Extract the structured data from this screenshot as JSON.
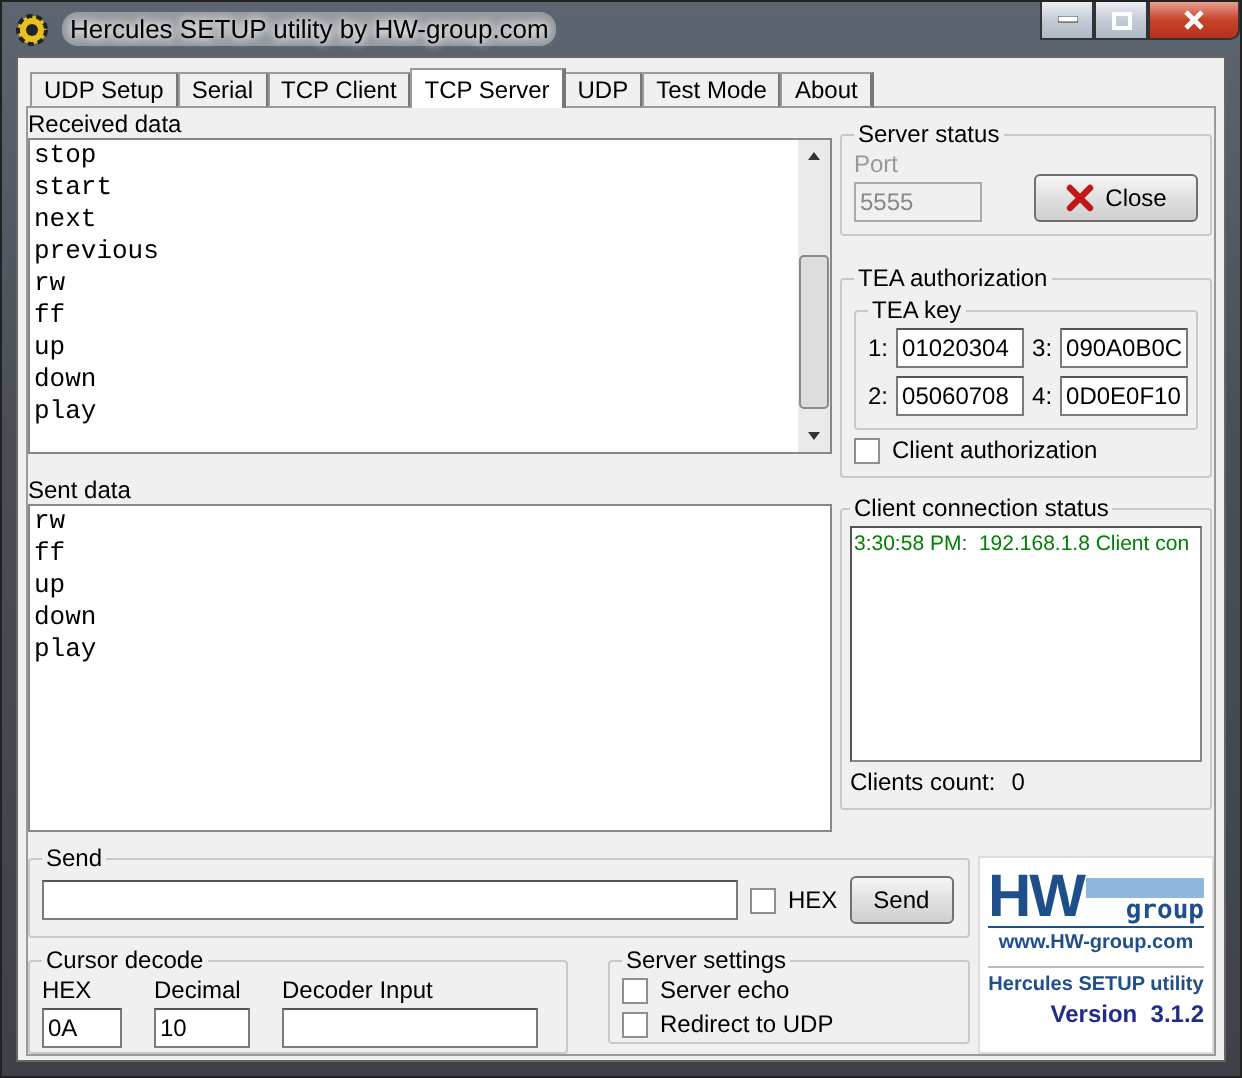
{
  "window": {
    "title": "Hercules SETUP utility by HW-group.com"
  },
  "tabs": [
    {
      "label": "UDP Setup",
      "selected": false
    },
    {
      "label": "Serial",
      "selected": false
    },
    {
      "label": "TCP Client",
      "selected": false
    },
    {
      "label": "TCP Server",
      "selected": true
    },
    {
      "label": "UDP",
      "selected": false
    },
    {
      "label": "Test Mode",
      "selected": false
    },
    {
      "label": "About",
      "selected": false
    }
  ],
  "received": {
    "title": "Received data",
    "lines": [
      "stop",
      "start",
      "next",
      "previous",
      "rw",
      "ff",
      "up",
      "down",
      "play"
    ]
  },
  "sent": {
    "title": "Sent data",
    "lines": [
      "rw",
      "ff",
      "up",
      "down",
      "play"
    ]
  },
  "server_status": {
    "title": "Server status",
    "port_label": "Port",
    "port": "5555",
    "button": "Close"
  },
  "tea": {
    "title": "TEA authorization",
    "key_title": "TEA key",
    "keys": [
      {
        "label": "1:",
        "value": "01020304"
      },
      {
        "label": "3:",
        "value": "090A0B0C"
      },
      {
        "label": "2:",
        "value": "05060708"
      },
      {
        "label": "4:",
        "value": "0D0E0F10"
      }
    ],
    "client_auth": {
      "label": "Client authorization",
      "checked": false
    }
  },
  "client_status": {
    "title": "Client connection status",
    "entries": [
      "3:30:58 PM:  192.168.1.8 Client con"
    ],
    "count_label": "Clients count:",
    "count": "0"
  },
  "send": {
    "title": "Send",
    "hex": {
      "label": "HEX",
      "checked": false
    },
    "button": "Send"
  },
  "cursor_decode": {
    "title": "Cursor decode",
    "fields": [
      {
        "label": "HEX",
        "value": "0A"
      },
      {
        "label": "Decimal",
        "value": "10"
      },
      {
        "label": "Decoder Input"
      }
    ]
  },
  "server_settings": {
    "title": "Server settings",
    "options": [
      {
        "label": "Server echo",
        "checked": false
      },
      {
        "label": "Redirect to UDP",
        "checked": false
      }
    ]
  },
  "logo": {
    "mark": "HW",
    "group": "group",
    "url": "www.HW-group.com",
    "product": "Hercules SETUP utility",
    "version": "Version  3.1.2"
  }
}
